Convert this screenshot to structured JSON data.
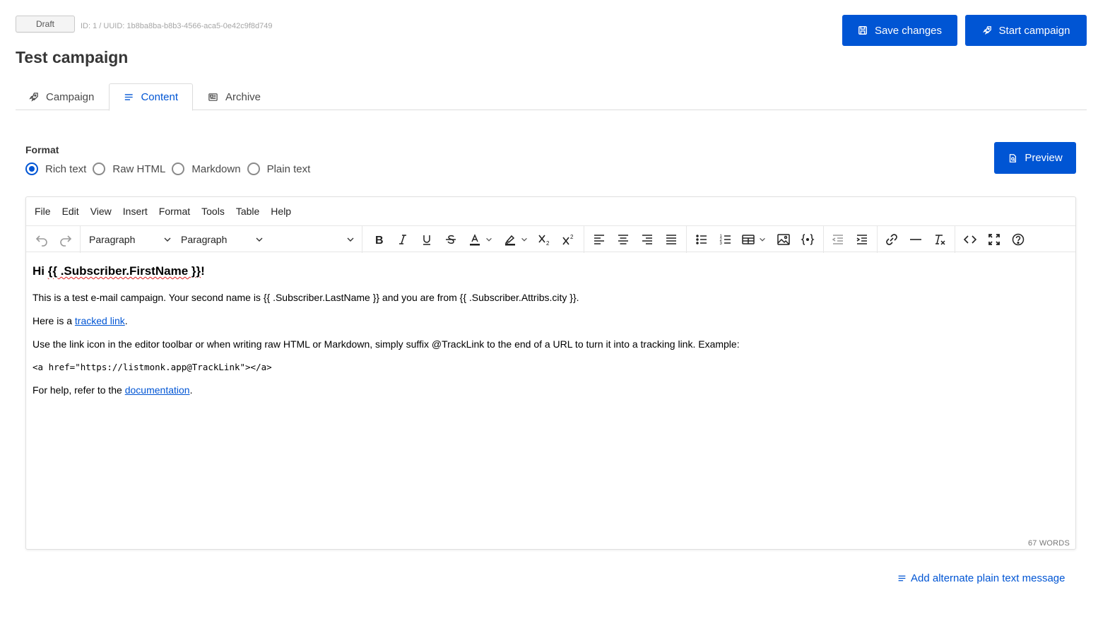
{
  "header": {
    "status": "Draft",
    "meta": "ID: 1 / UUID: 1b8ba8ba-b8b3-4566-aca5-0e42c9f8d749",
    "title": "Test campaign",
    "save_label": "Save changes",
    "start_label": "Start campaign"
  },
  "tabs": [
    {
      "label": "Campaign",
      "icon": "rocket-icon"
    },
    {
      "label": "Content",
      "icon": "lines-icon",
      "active": true
    },
    {
      "label": "Archive",
      "icon": "newspaper-icon"
    }
  ],
  "format": {
    "label": "Format",
    "options": [
      {
        "label": "Rich text",
        "checked": true
      },
      {
        "label": "Raw HTML"
      },
      {
        "label": "Markdown"
      },
      {
        "label": "Plain text"
      }
    ],
    "preview_label": "Preview"
  },
  "editor": {
    "menu": [
      "File",
      "Edit",
      "View",
      "Insert",
      "Format",
      "Tools",
      "Table",
      "Help"
    ],
    "block_select": "Paragraph",
    "style_select": "Paragraph",
    "word_count": "67 WORDS",
    "body": {
      "heading_prefix": "Hi ",
      "heading_var": "{{ .Subscriber.FirstName }}",
      "heading_suffix": "!",
      "p1": "This is a test e-mail campaign. Your second name is {{ .Subscriber.LastName }} and you are from {{ .Subscriber.Attribs.city }}.",
      "p2_prefix": "Here is a ",
      "p2_link": "tracked link",
      "p2_suffix": ".",
      "p3": "Use the link icon in the editor toolbar or when writing raw HTML or Markdown, simply suffix @TrackLink to the end of a URL to turn it into a tracking link. Example:",
      "code": "<a href=\"https://listmonk.app@TrackLink\"></a>",
      "p4_prefix": "For help, refer to the ",
      "p4_link": "documentation",
      "p4_suffix": "."
    }
  },
  "alt_link": "Add alternate plain text message",
  "colors": {
    "primary": "#0055d4",
    "spell": "#e02020"
  }
}
